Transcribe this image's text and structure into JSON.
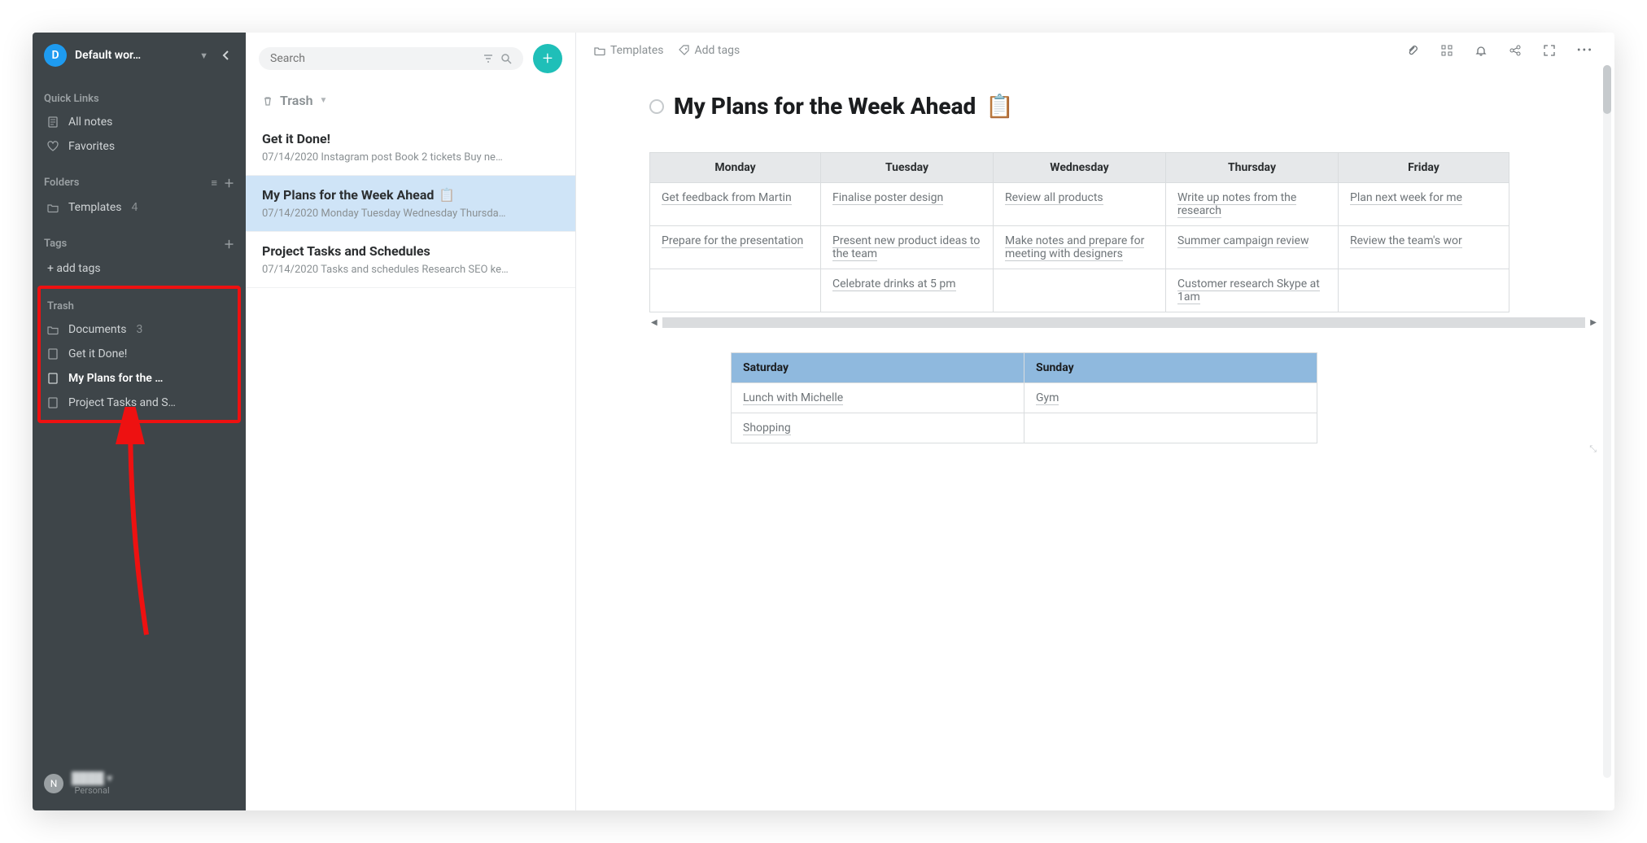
{
  "workspace": {
    "avatar_letter": "D",
    "name": "Default wor…"
  },
  "sidebar": {
    "quick_links_label": "Quick Links",
    "all_notes": "All notes",
    "favorites": "Favorites",
    "folders_label": "Folders",
    "folders": {
      "templates_label": "Templates",
      "templates_count": "4"
    },
    "tags_label": "Tags",
    "add_tags": "+ add tags",
    "trash_label": "Trash",
    "trash": {
      "documents_label": "Documents",
      "documents_count": "3",
      "item1": "Get it Done!",
      "item2": "My Plans for the …",
      "item3": "Project Tasks and S…"
    },
    "footer": {
      "avatar_letter": "N",
      "plan": "Personal"
    }
  },
  "search": {
    "placeholder": "Search"
  },
  "notelist": {
    "title": "Trash",
    "items": [
      {
        "title": "Get it Done!",
        "subtitle": "07/14/2020 Instagram post Book 2 tickets Buy ne…"
      },
      {
        "title": "My Plans for the Week Ahead",
        "subtitle": "07/14/2020 Monday Tuesday Wednesday Thursda…"
      },
      {
        "title": "Project Tasks and Schedules",
        "subtitle": "07/14/2020 Tasks and schedules Research SEO ke…"
      }
    ]
  },
  "breadcrumb": {
    "folder": "Templates",
    "add_tags": "Add tags"
  },
  "doc": {
    "title": "My Plans for the Week Ahead",
    "emoji": "📋"
  },
  "week": {
    "headers": [
      "Monday",
      "Tuesday",
      "Wednesday",
      "Thursday",
      "Friday"
    ],
    "rows": [
      [
        "Get feedback from Martin",
        "Finalise poster design",
        "Review all products",
        "Write up notes from the research",
        "Plan next week for me"
      ],
      [
        "Prepare for the presentation",
        "Present new product ideas to the team",
        "Make notes and prepare for meeting with designers",
        "Summer campaign review",
        "Review the team's wor"
      ],
      [
        "",
        "Celebrate drinks at 5 pm",
        "",
        "Customer research Skype at 1am",
        ""
      ]
    ]
  },
  "weekend": {
    "headers": [
      "Saturday",
      "Sunday"
    ],
    "rows": [
      [
        "Lunch with Michelle",
        "Gym"
      ],
      [
        "Shopping",
        ""
      ]
    ]
  }
}
